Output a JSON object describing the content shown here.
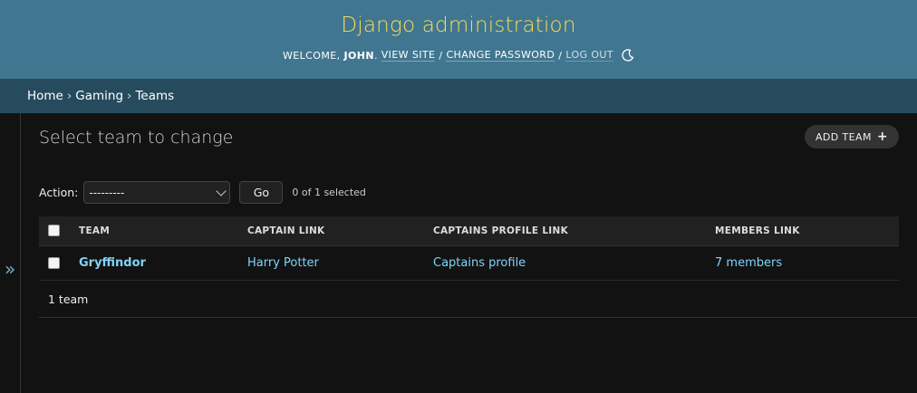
{
  "header": {
    "site_title": "Django administration",
    "welcome": "WELCOME,",
    "username": "JOHN",
    "username_suffix": ".",
    "view_site": "VIEW SITE",
    "change_password": "CHANGE PASSWORD",
    "log_out": "LOG OUT",
    "separator": "/"
  },
  "breadcrumbs": {
    "home": "Home",
    "app": "Gaming",
    "current": "Teams",
    "separator": "›"
  },
  "sidebar_toggle": {
    "icon": "»"
  },
  "content": {
    "title": "Select team to change",
    "add_button": "ADD TEAM",
    "add_icon": "+"
  },
  "actions": {
    "label": "Action:",
    "selected_option": "---------",
    "go_label": "Go",
    "counter": "0 of 1 selected"
  },
  "table": {
    "columns": [
      "TEAM",
      "CAPTAIN LINK",
      "CAPTAINS PROFILE LINK",
      "MEMBERS LINK"
    ],
    "rows": [
      {
        "team": "Gryffindor",
        "captain": "Harry Potter",
        "profile": "Captains profile",
        "members": "7 members"
      }
    ]
  },
  "paginator": {
    "count": "1 team"
  },
  "colors": {
    "header_bg": "#417690",
    "site_title": "#f5dd5d",
    "breadcrumbs_bg": "#264b5d",
    "link": "#81d4fa",
    "body_bg": "#121212"
  }
}
